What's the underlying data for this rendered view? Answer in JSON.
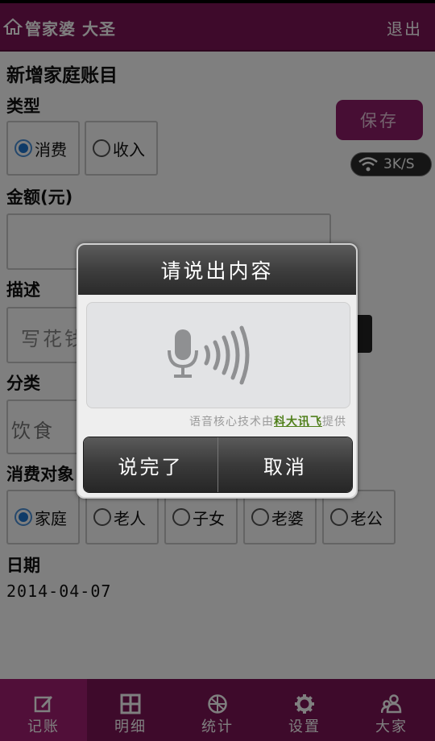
{
  "header": {
    "title": "管家婆 大圣",
    "logout_label": "退出"
  },
  "form": {
    "title": "新增家庭账目",
    "type_label": "类型",
    "type_options": [
      {
        "label": "消费",
        "selected": true
      },
      {
        "label": "收入",
        "selected": false
      }
    ],
    "save_label": "保存",
    "net_speed": "3K/S",
    "amount_label": "金额(元)",
    "amount_value": "",
    "desc_label": "描述",
    "desc_placeholder": "写花钱",
    "category_label": "分类",
    "category_value": "饮食",
    "target_label": "消费对象",
    "target_options": [
      {
        "label": "家庭",
        "selected": true
      },
      {
        "label": "老人",
        "selected": false
      },
      {
        "label": "子女",
        "selected": false
      },
      {
        "label": "老婆",
        "selected": false
      },
      {
        "label": "老公",
        "selected": false
      }
    ],
    "date_label": "日期",
    "date_value": "2014-04-07"
  },
  "tabs": [
    {
      "label": "记账",
      "icon": "edit-icon",
      "active": true
    },
    {
      "label": "明细",
      "icon": "grid-icon",
      "active": false
    },
    {
      "label": "统计",
      "icon": "chart-icon",
      "active": false
    },
    {
      "label": "设置",
      "icon": "gear-icon",
      "active": false
    },
    {
      "label": "大家",
      "icon": "people-icon",
      "active": false
    }
  ],
  "dialog": {
    "title": "请说出内容",
    "credit_prefix": "语音核心技术由",
    "credit_link": "科大讯飞",
    "credit_suffix": "提供",
    "done_label": "说完了",
    "cancel_label": "取消"
  },
  "colors": {
    "brand": "#7d1457",
    "accent": "#a21e73",
    "radio": "#1f77d0"
  }
}
